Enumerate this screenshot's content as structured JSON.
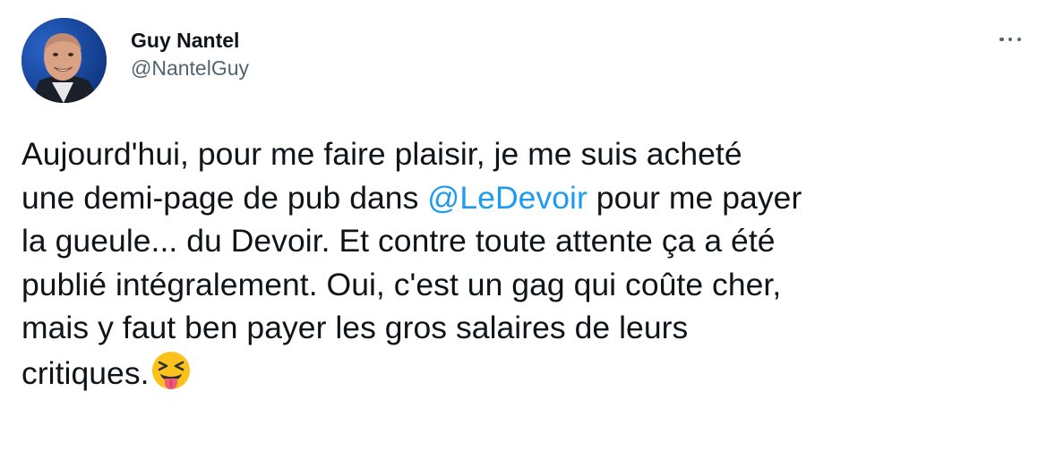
{
  "author": {
    "display_name": "Guy Nantel",
    "handle": "@NantelGuy"
  },
  "tweet": {
    "line1": "Aujourd'hui, pour me faire plaisir, je me suis acheté",
    "line2_pre": "une demi-page de pub dans ",
    "mention": "@LeDevoir",
    "line2_post": " pour me payer",
    "line3": "la gueule... du Devoir. Et contre toute attente ça a été",
    "line4": "publié intégralement. Oui, c'est un gag qui coûte cher,",
    "line5": "mais y faut ben payer les gros salaires de leurs",
    "line6": "critiques.",
    "emoji": "squinting-face-with-tongue"
  },
  "colors": {
    "text": "#0f1419",
    "secondary": "#536471",
    "link": "#1d9bf0"
  },
  "icons": {
    "more": "more-options-icon"
  }
}
